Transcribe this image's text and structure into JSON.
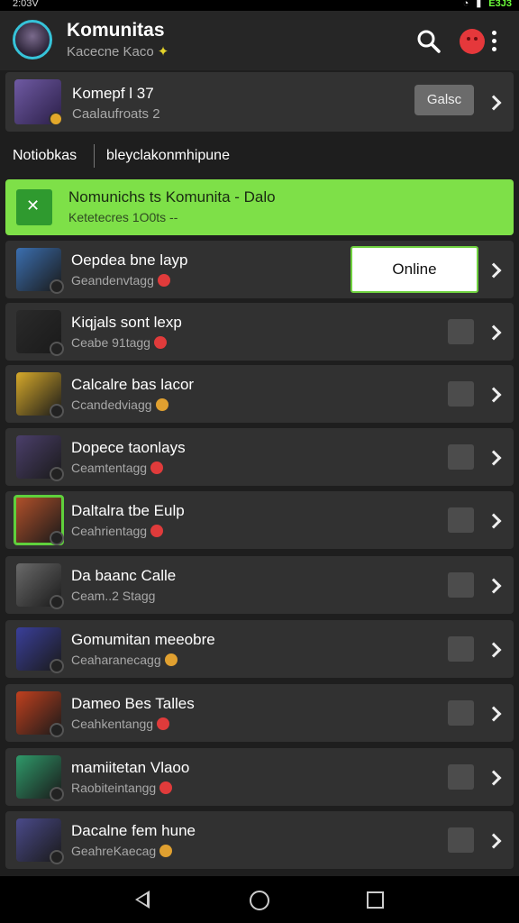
{
  "status_bar": {
    "time": "2:03V",
    "battery": "E3J3"
  },
  "app_bar": {
    "title": "Komunitas",
    "subtitle": "Kacecne Kaco",
    "icons": [
      "search-icon",
      "notification-face-icon",
      "more-vert-icon"
    ]
  },
  "profile": {
    "name": "Komepf l 37",
    "subtitle": "Caalaufroats 2",
    "button_label": "Galsc"
  },
  "tabs": [
    {
      "label": "Notiobkas"
    },
    {
      "label": "bleyclakonmhipune"
    }
  ],
  "banner": {
    "title": "Nomunichs ts Komunita - Dalo",
    "subtitle": "Ketetecres 1O0ts --",
    "color": "#7ee048"
  },
  "items": [
    {
      "title": "Oepdea bne layp",
      "subtitle": "Geandenvtagg",
      "thumb_color": "#3b6fb0",
      "heart_color": "#e03b3b",
      "action": "Online"
    },
    {
      "title": "Kiqjals sont lexp",
      "subtitle": "Ceabe 91tagg",
      "thumb_color": "#2a2a2a",
      "heart_color": "#e03b3b",
      "action": ""
    },
    {
      "title": "Calcalre bas lacor",
      "subtitle": "Ccandedviagg",
      "thumb_color": "#d6a92a",
      "heart_color": "#e0a030",
      "action": ""
    },
    {
      "title": "Dopece taonlays",
      "subtitle": "Ceamtentagg",
      "thumb_color": "#4b3f6b",
      "heart_color": "#e03b3b",
      "action": ""
    },
    {
      "title": "Daltalra tbe Eulp",
      "subtitle": "Ceahrientagg",
      "thumb_color": "#b0502a",
      "heart_color": "#e03b3b",
      "action": "",
      "highlighted": true
    },
    {
      "title": "Da baanc Calle",
      "subtitle": "Ceam..2 Stagg",
      "thumb_color": "#6a6a6a",
      "heart_color": "",
      "action": ""
    },
    {
      "title": "Gomumitan meeobre",
      "subtitle": "Ceaharanecagg",
      "thumb_color": "#3a3f9a",
      "heart_color": "#e0a030",
      "action": ""
    },
    {
      "title": "Dameo Bes Talles",
      "subtitle": "Ceahkentangg",
      "thumb_color": "#c0401e",
      "heart_color": "#e03b3b",
      "action": ""
    },
    {
      "title": "mamiitetan Vlaoo",
      "subtitle": "Raobiteintangg",
      "thumb_color": "#2f9a6a",
      "heart_color": "#e03b3b",
      "action": ""
    },
    {
      "title": "Dacalne fem hune",
      "subtitle": "GeahreKaecag",
      "thumb_color": "#4a4a8a",
      "heart_color": "#e0a030",
      "action": ""
    }
  ]
}
